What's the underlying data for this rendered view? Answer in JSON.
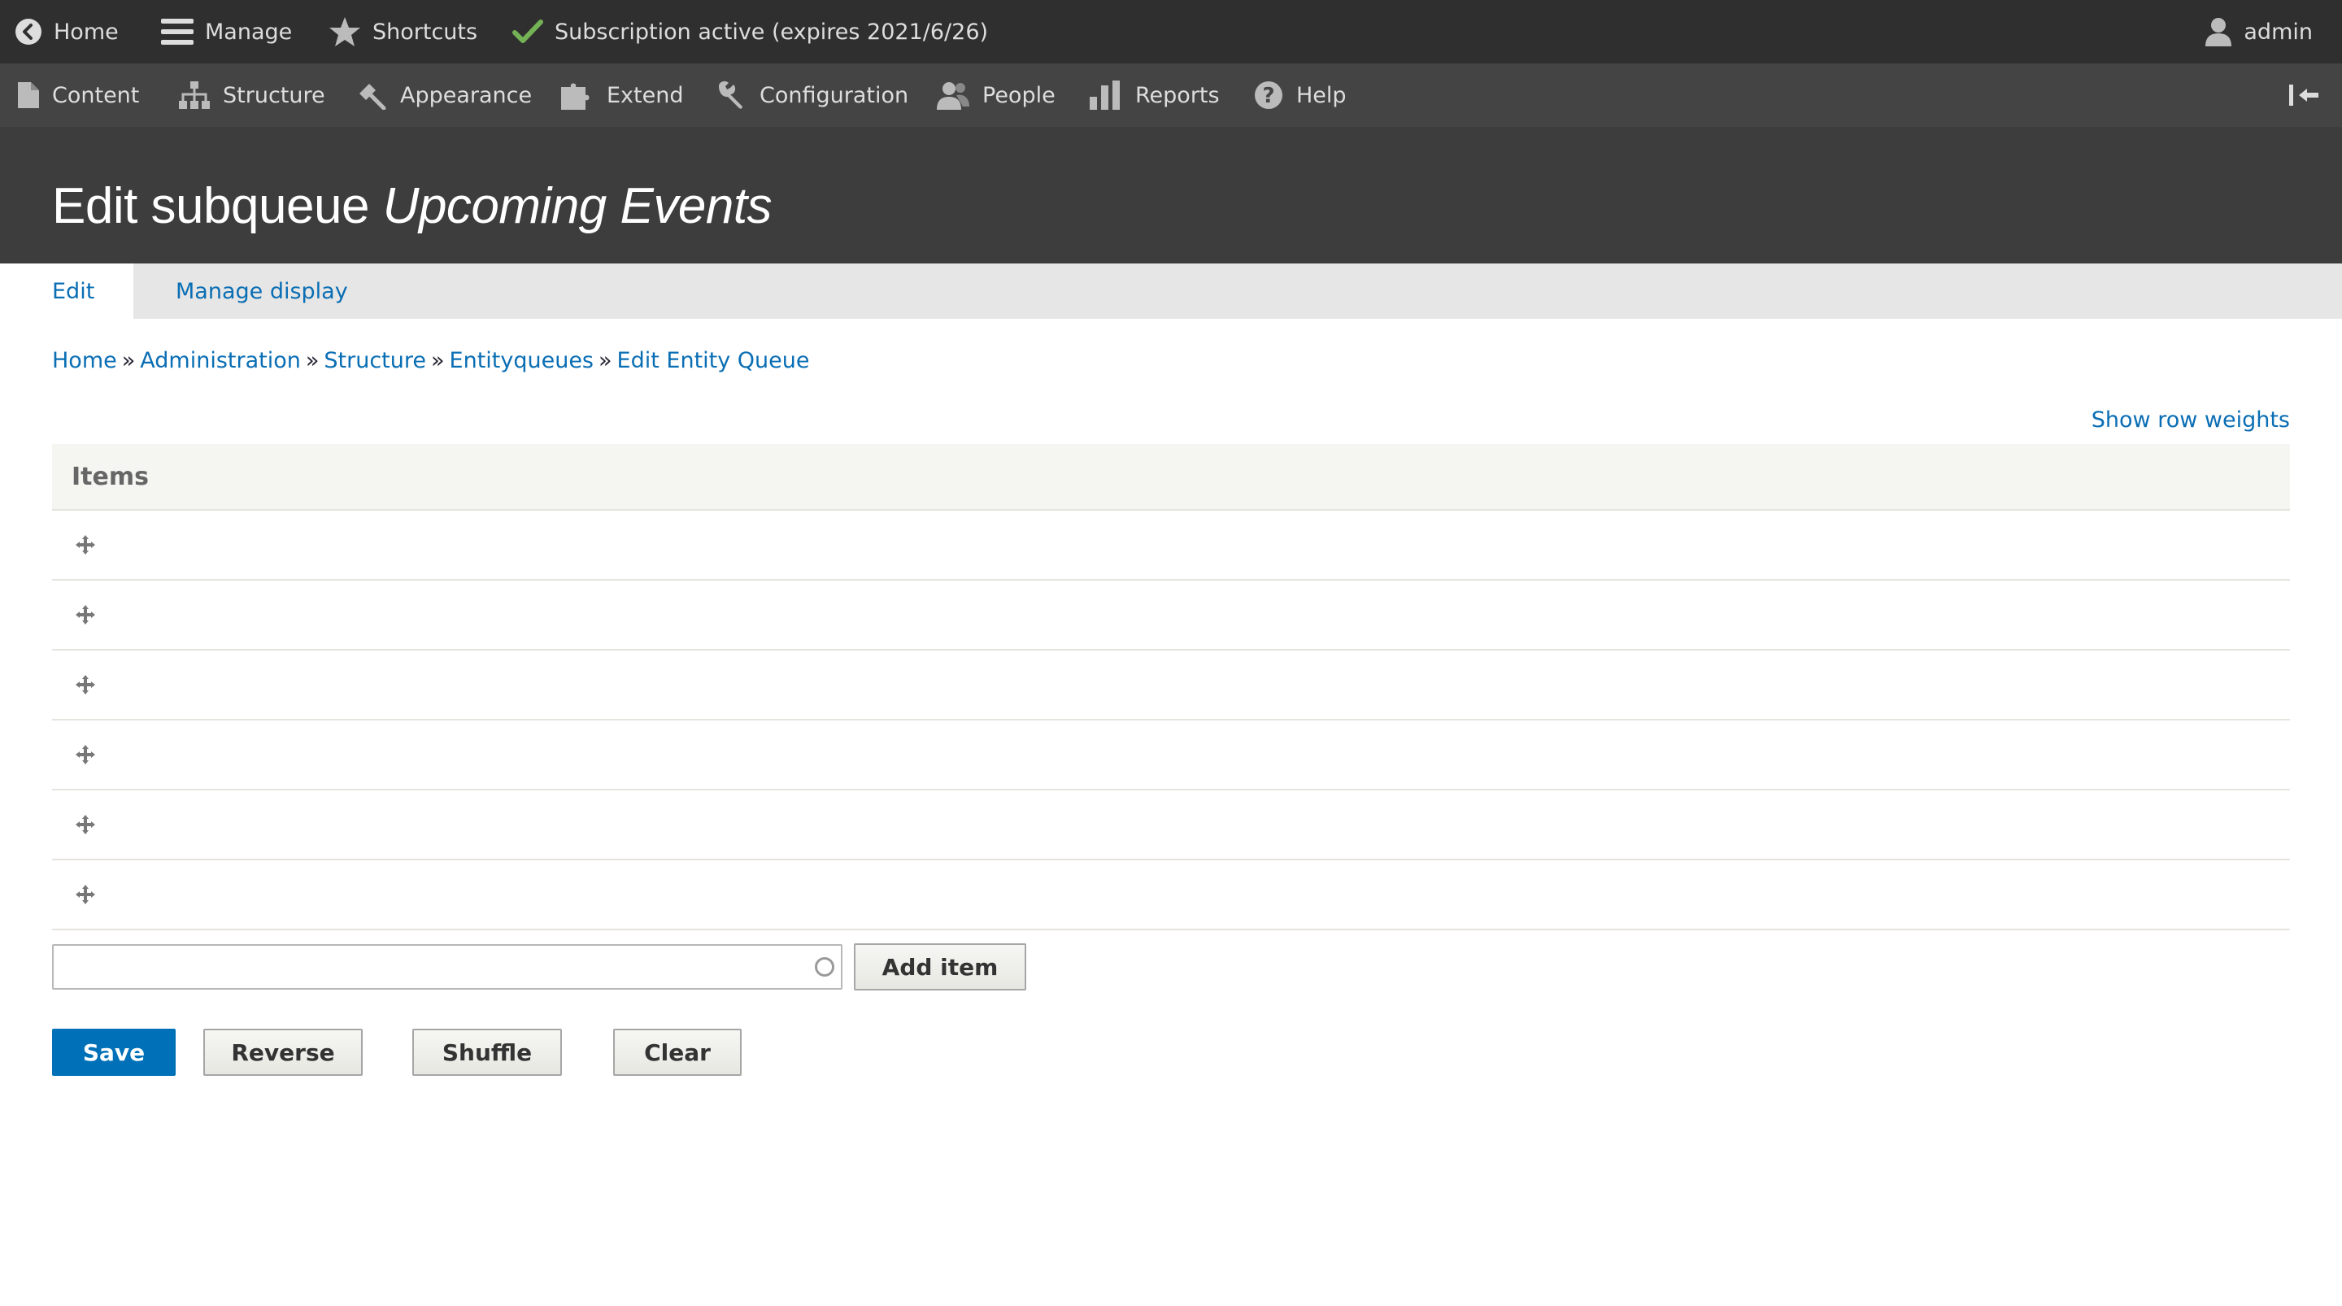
{
  "toolbar": {
    "home_label": "Home",
    "manage_label": "Manage",
    "shortcuts_label": "Shortcuts",
    "subscription_label": "Subscription active (expires 2021/6/26)",
    "user_label": "admin"
  },
  "tray": {
    "items": [
      {
        "label": "Content",
        "icon": "file-icon"
      },
      {
        "label": "Structure",
        "icon": "sitemap-icon"
      },
      {
        "label": "Appearance",
        "icon": "paintbrush-icon"
      },
      {
        "label": "Extend",
        "icon": "puzzle-icon"
      },
      {
        "label": "Configuration",
        "icon": "wrench-icon"
      },
      {
        "label": "People",
        "icon": "people-icon"
      },
      {
        "label": "Reports",
        "icon": "bar-chart-icon"
      },
      {
        "label": "Help",
        "icon": "help-icon"
      }
    ]
  },
  "header": {
    "title_prefix": "Edit subqueue",
    "title_emphasis": "Upcoming Events"
  },
  "tabs": [
    {
      "label": "Edit",
      "active": true
    },
    {
      "label": "Manage display",
      "active": false
    }
  ],
  "breadcrumb": [
    "Home",
    "Administration",
    "Structure",
    "Entityqueues",
    "Edit Entity Queue"
  ],
  "breadcrumb_separator": "»",
  "table": {
    "show_weights_label": "Show row weights",
    "header": "Items",
    "row_count": 6
  },
  "autocomplete": {
    "value": "",
    "placeholder": ""
  },
  "buttons": {
    "add_item": "Add item",
    "save": "Save",
    "reverse": "Reverse",
    "shuffle": "Shuffle",
    "clear": "Clear"
  },
  "colors": {
    "link": "#0a6eb4",
    "primary_button": "#0071b8",
    "toolbar_bar": "#2f2f2f",
    "toolbar_tray": "#444444",
    "header_bg": "#3d3d3d",
    "check_green": "#73b355"
  }
}
